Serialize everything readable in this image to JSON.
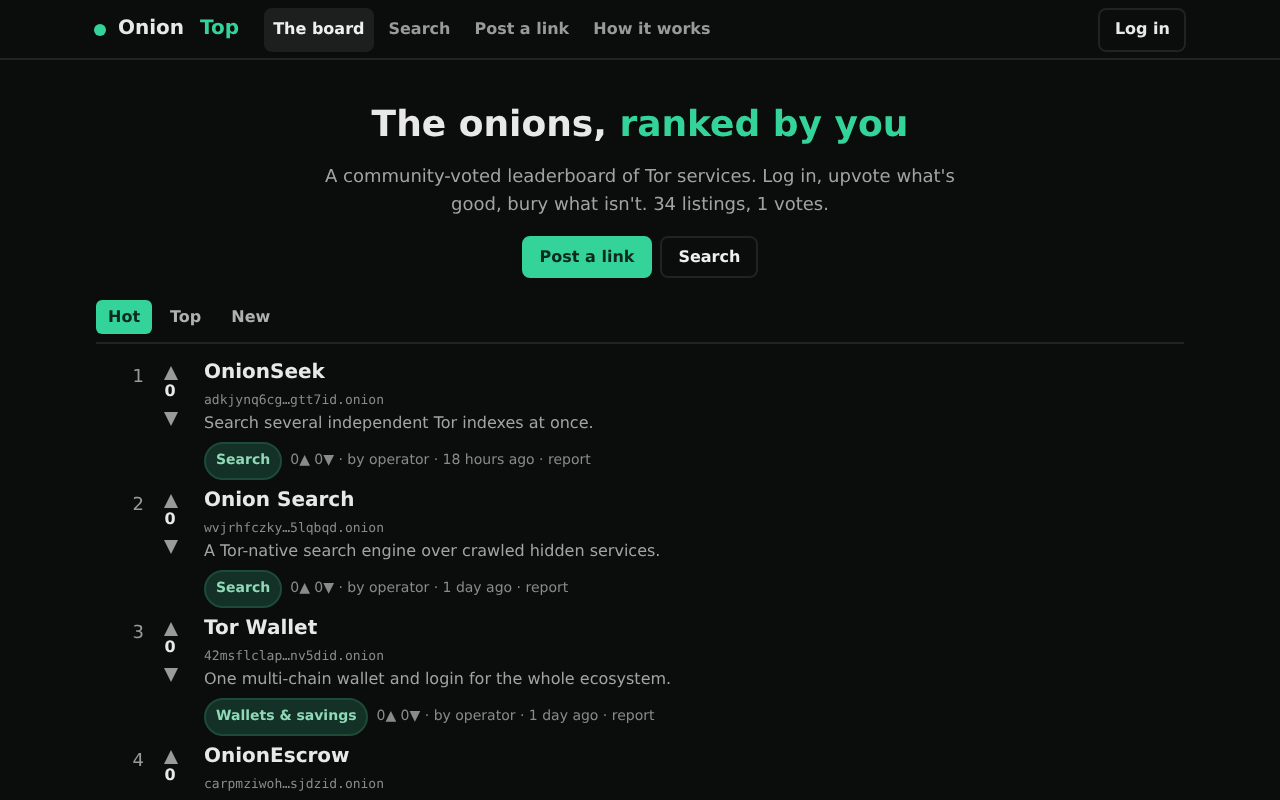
{
  "brand": {
    "word1": "Onion",
    "word2": "Top"
  },
  "nav": [
    {
      "label": "The board",
      "selected": true
    },
    {
      "label": "Search",
      "selected": false
    },
    {
      "label": "Post a link",
      "selected": false
    },
    {
      "label": "How it works",
      "selected": false
    }
  ],
  "login": "Log in",
  "hero": {
    "title": "The onions, ",
    "title_accent": "ranked by you",
    "subtitle": "A community-voted leaderboard of Tor services. Log in, upvote what's good, bury what isn't. 34 listings, 1 votes.",
    "buttons": [
      {
        "label": "Post a link",
        "kind": "primary"
      },
      {
        "label": "Search",
        "kind": "secondary"
      }
    ]
  },
  "sort_tabs": [
    {
      "label": "Hot",
      "selected": true
    },
    {
      "label": "Top",
      "selected": false
    },
    {
      "label": "New",
      "selected": false
    }
  ],
  "listings": [
    {
      "rank": "1",
      "score": "0",
      "title": "OnionSeek",
      "address": "adkjynq6cg…gtt7id.onion",
      "description": "Search several independent Tor indexes at once.",
      "tag": "Search",
      "meta": "0▲ 0▼ · by operator · 18 hours ago · report"
    },
    {
      "rank": "2",
      "score": "0",
      "title": "Onion Search",
      "address": "wvjrhfczky…5lqbqd.onion",
      "description": "A Tor-native search engine over crawled hidden services.",
      "tag": "Search",
      "meta": "0▲ 0▼ · by operator · 1 day ago · report"
    },
    {
      "rank": "3",
      "score": "0",
      "title": "Tor Wallet",
      "address": "42msflclap…nv5did.onion",
      "description": "One multi-chain wallet and login for the whole ecosystem.",
      "tag": "Wallets & savings",
      "meta": "0▲ 0▼ · by operator · 1 day ago · report"
    },
    {
      "rank": "4",
      "score": "0",
      "title": "OnionEscrow",
      "address": "carpmziwoh…sjdzid.onion"
    }
  ]
}
